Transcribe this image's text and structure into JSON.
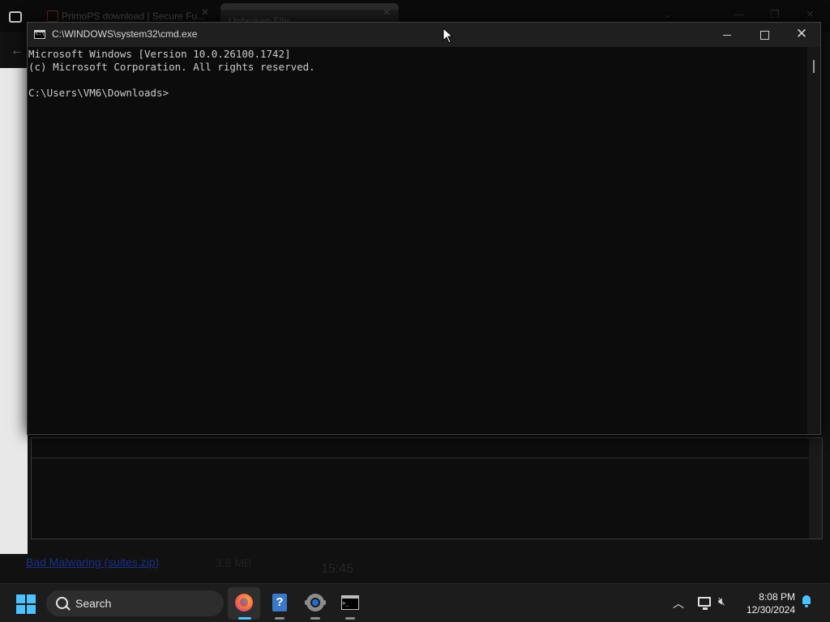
{
  "background_browser": {
    "tabs": [
      {
        "label": "PrimoPS download | Secure Fu..."
      },
      {
        "label": "Unbroken File..."
      }
    ],
    "link_text": "Bad Malwaring (suites.zip)",
    "size_text": "3.8 MB",
    "time_text": "15:45"
  },
  "cmd_window": {
    "title": "C:\\WINDOWS\\system32\\cmd.exe",
    "console_lines": [
      "Microsoft Windows [Version 10.0.26100.1742]",
      "(c) Microsoft Corporation. All rights reserved.",
      "",
      "C:\\Users\\VM6\\Downloads>"
    ],
    "icon": "cmd-icon",
    "controls": [
      "minimize-icon",
      "maximize-icon",
      "close-icon"
    ]
  },
  "taskbar": {
    "search_label": "Search",
    "apps": [
      {
        "name": "Firefox",
        "icon": "firefox-icon",
        "active": true
      },
      {
        "name": "Help",
        "icon": "help-icon",
        "active": false
      },
      {
        "name": "Settings",
        "icon": "settings-icon",
        "active": false
      },
      {
        "name": "Command Prompt",
        "icon": "terminal-icon",
        "active": false
      }
    ],
    "clock": {
      "time": "8:08 PM",
      "date": "12/30/2024"
    }
  },
  "colors": {
    "accent": "#4cc2ff",
    "console_text": "#cccccc",
    "console_bg": "#0c0c0c",
    "taskbar_bg": "#1c1c1c"
  }
}
